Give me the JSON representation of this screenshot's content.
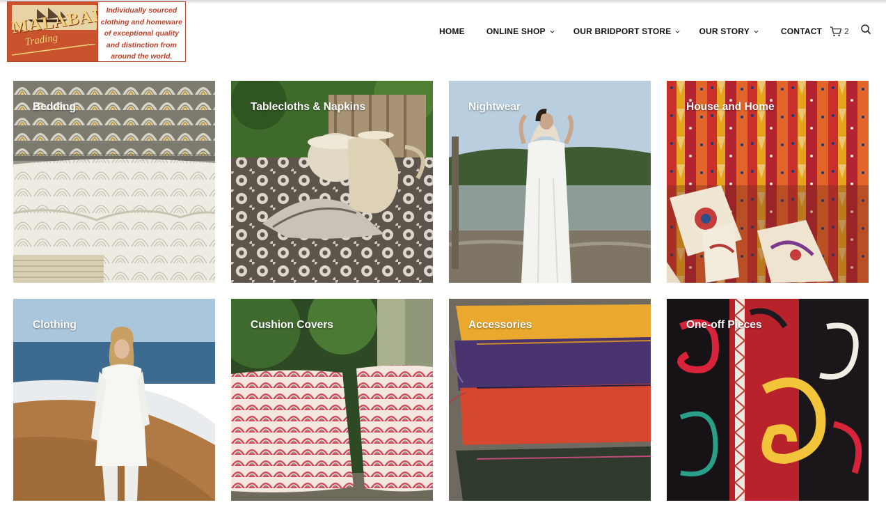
{
  "brand": {
    "logo_name": "MALABAR",
    "logo_sub": "Trading",
    "tagline_lines": [
      "Individually sourced",
      "clothing and homeware",
      "of exceptional quality",
      "and distinction from",
      "around the world."
    ]
  },
  "nav": {
    "items": [
      {
        "label": "HOME",
        "dropdown": false
      },
      {
        "label": "ONLINE SHOP",
        "dropdown": true
      },
      {
        "label": "OUR BRIDPORT STORE",
        "dropdown": true
      },
      {
        "label": "OUR STORY",
        "dropdown": true
      },
      {
        "label": "CONTACT",
        "dropdown": false
      }
    ],
    "cart_count": "2"
  },
  "categories": [
    {
      "label": "Bedding"
    },
    {
      "label": "Tablecloths & Napkins"
    },
    {
      "label": "Nightwear"
    },
    {
      "label": "House and Home"
    },
    {
      "label": "Clothing"
    },
    {
      "label": "Cushion Covers"
    },
    {
      "label": "Accessories"
    },
    {
      "label": "One-off Pieces"
    }
  ],
  "colors": {
    "logo_red": "#c8532d",
    "logo_gold": "#f1d27a",
    "tagline_red": "#c0412a"
  }
}
